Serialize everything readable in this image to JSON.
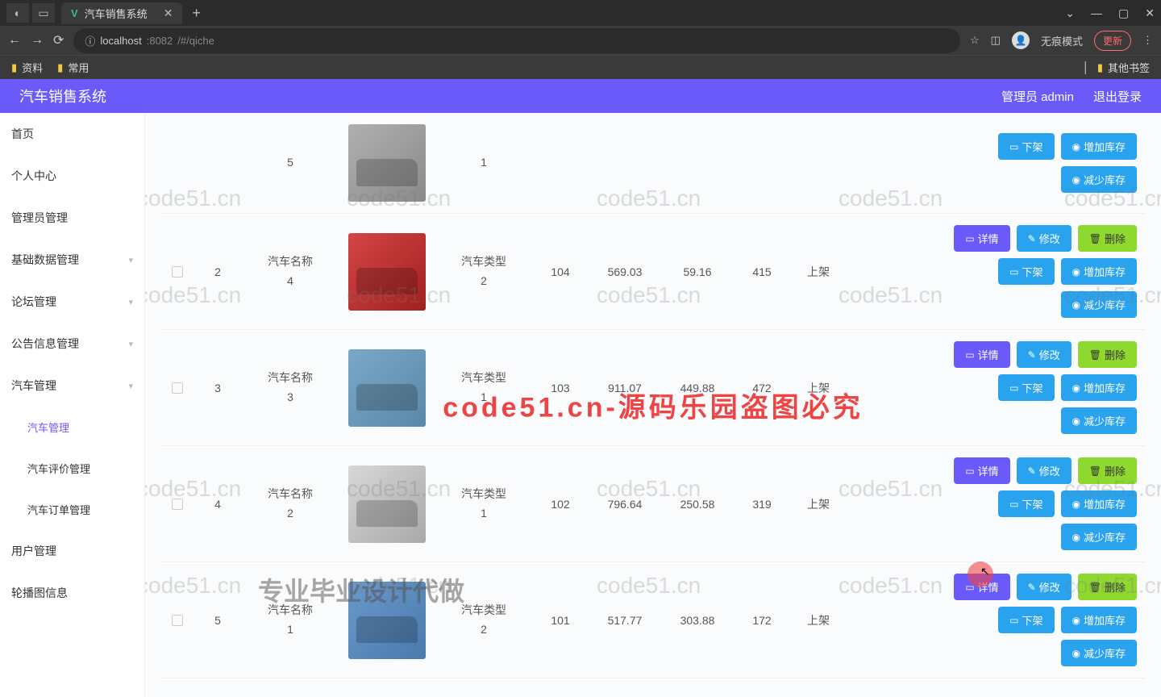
{
  "browser": {
    "tab_title": "汽车销售系统",
    "url_host": "localhost",
    "url_port": ":8082",
    "url_path": "/#/qiche",
    "incognito_label": "无痕模式",
    "update_label": "更新",
    "bookmarks": [
      "资料",
      "常用"
    ],
    "other_bookmarks": "其他书签"
  },
  "header": {
    "app_title": "汽车销售系统",
    "admin_label": "管理员 admin",
    "logout_label": "退出登录"
  },
  "sidebar": {
    "items": [
      {
        "label": "首页",
        "sub": false
      },
      {
        "label": "个人中心",
        "sub": false
      },
      {
        "label": "管理员管理",
        "sub": false
      },
      {
        "label": "基础数据管理",
        "sub": false,
        "chev": true
      },
      {
        "label": "论坛管理",
        "sub": false,
        "chev": true
      },
      {
        "label": "公告信息管理",
        "sub": false,
        "chev": true
      },
      {
        "label": "汽车管理",
        "sub": false,
        "chev": true
      },
      {
        "label": "汽车管理",
        "sub": true,
        "active": true
      },
      {
        "label": "汽车评价管理",
        "sub": true
      },
      {
        "label": "汽车订单管理",
        "sub": true
      },
      {
        "label": "用户管理",
        "sub": false
      },
      {
        "label": "轮播图信息",
        "sub": false
      }
    ]
  },
  "table": {
    "name_prefix": "汽车名称",
    "type_prefix": "汽车类型",
    "rows": [
      {
        "idx": "",
        "name_sub": "5",
        "type_sub": "1",
        "n1": "",
        "n2": "",
        "n3": "",
        "n4": "",
        "status": "",
        "img": "gray",
        "partial": true
      },
      {
        "idx": "2",
        "name_sub": "4",
        "type_sub": "2",
        "n1": "104",
        "n2": "569.03",
        "n3": "59.16",
        "n4": "415",
        "status": "上架",
        "img": "red"
      },
      {
        "idx": "3",
        "name_sub": "3",
        "type_sub": "1",
        "n1": "103",
        "n2": "911.07",
        "n3": "449.88",
        "n4": "472",
        "status": "上架",
        "img": "blue"
      },
      {
        "idx": "4",
        "name_sub": "2",
        "type_sub": "1",
        "n1": "102",
        "n2": "796.64",
        "n3": "250.58",
        "n4": "319",
        "status": "上架",
        "img": "silver"
      },
      {
        "idx": "5",
        "name_sub": "1",
        "type_sub": "2",
        "n1": "101",
        "n2": "517.77",
        "n3": "303.88",
        "n4": "172",
        "status": "上架",
        "img": "blue2"
      }
    ]
  },
  "ops": {
    "detail": "详情",
    "edit": "修改",
    "delete": "删除",
    "unshelve": "下架",
    "add_stock": "增加库存",
    "reduce_stock": "减少库存"
  },
  "watermark": {
    "text": "code51.cn",
    "red_text": "code51.cn-源码乐园盗图必究",
    "bottom_text": "专业毕业设计代做"
  }
}
